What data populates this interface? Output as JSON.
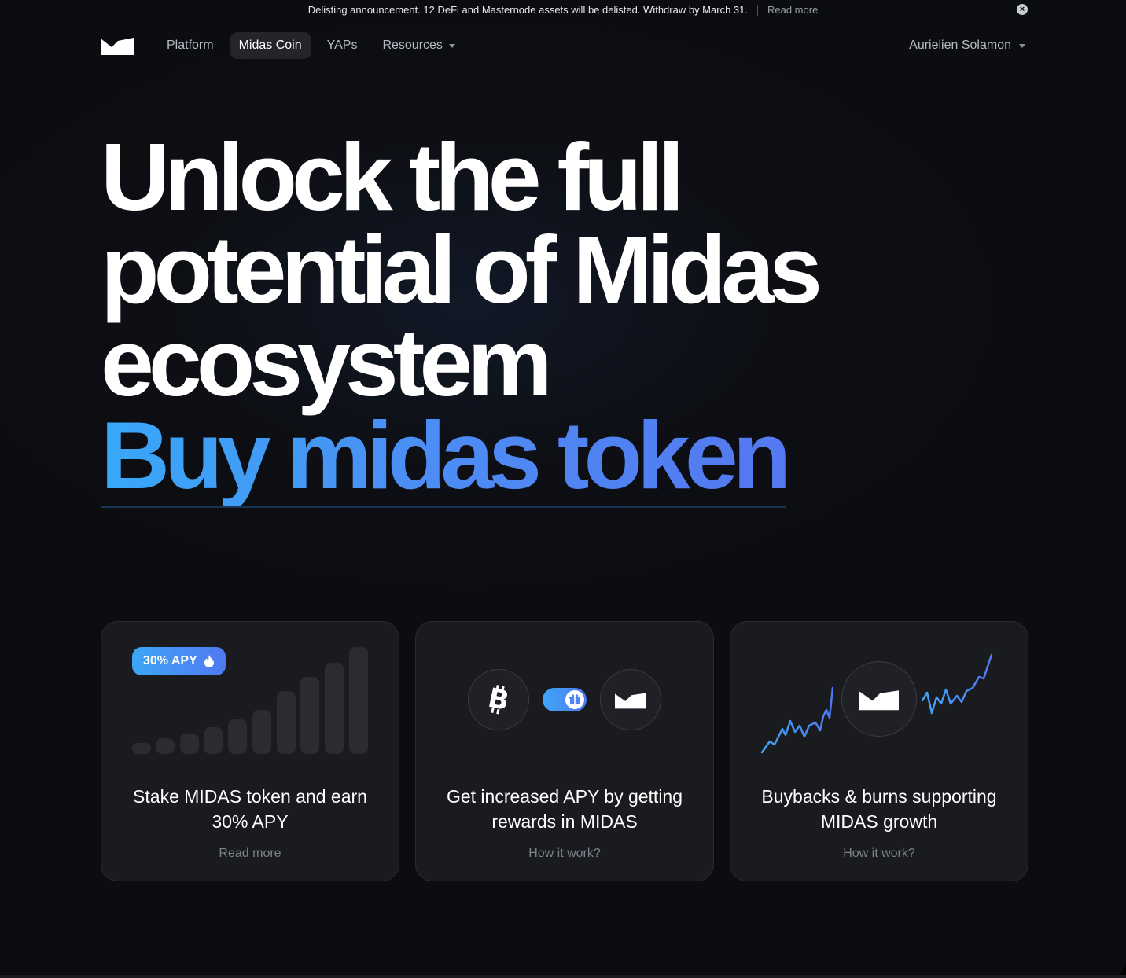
{
  "announcement": {
    "text": "Delisting announcement. 12 DeFi and Masternode assets will be delisted. Withdraw by March 31.",
    "link": "Read more",
    "close_icon": "close-icon"
  },
  "nav": {
    "items": [
      {
        "label": "Platform",
        "active": false
      },
      {
        "label": "Midas Coin",
        "active": true
      },
      {
        "label": "YAPs",
        "active": false
      },
      {
        "label": "Resources",
        "active": false,
        "dropdown": true
      }
    ],
    "user": "Aurielien Solamon"
  },
  "hero": {
    "lines": [
      "Unlock the full",
      "potential of Midas",
      "ecosystem"
    ],
    "cta": "Buy midas token"
  },
  "cards": [
    {
      "badge": "30% APY",
      "badge_icon": "flame-icon",
      "title": "Stake MIDAS token and earn 30% APY",
      "link": "Read more"
    },
    {
      "title": "Get increased APY by getting rewards in MIDAS",
      "link": "How it work?",
      "icons": [
        "bitcoin-icon",
        "gift-toggle-icon",
        "midas-logo-icon"
      ]
    },
    {
      "title": "Buybacks & burns supporting MIDAS growth",
      "link": "How it work?",
      "icons": [
        "trend-line-icon",
        "midas-logo-icon"
      ]
    }
  ],
  "colors": {
    "accent_start": "#3ea6f7",
    "accent_end": "#5179f1",
    "background": "#0c0d11",
    "card": "#1a1b1f"
  }
}
